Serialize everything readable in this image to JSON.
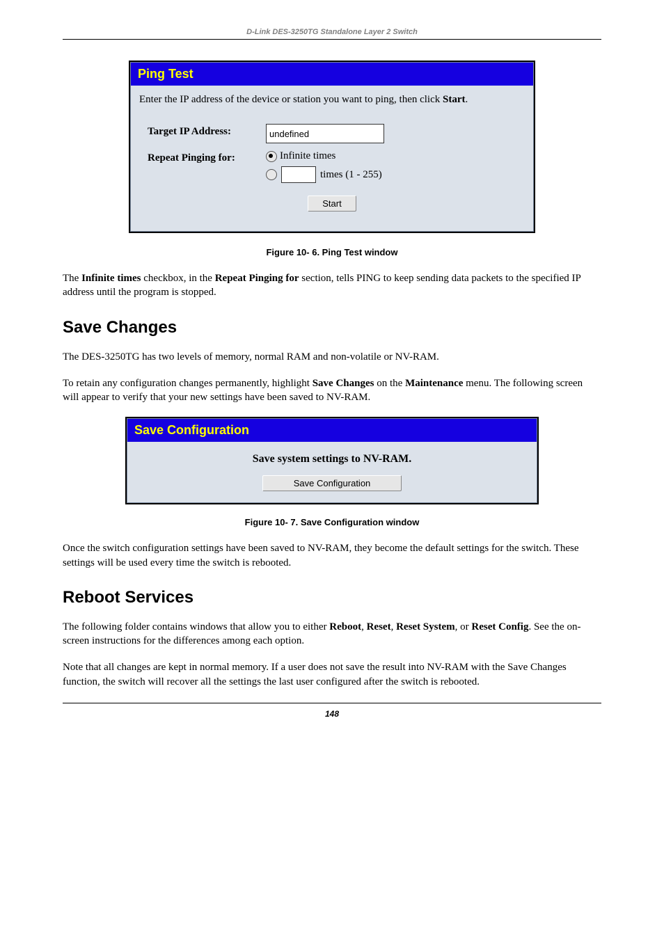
{
  "header": "D-Link DES-3250TG Standalone Layer 2 Switch",
  "ping": {
    "title": "Ping Test",
    "intro_prefix": "Enter the IP address of the device or station you want to ping, then click ",
    "intro_bold": "Start",
    "intro_suffix": ".",
    "target_label": "Target IP Address:",
    "target_value": "undefined",
    "repeat_label": "Repeat Pinging for:",
    "opt_infinite": "Infinite times",
    "times_suffix": "times (1 - 255)",
    "start_btn": "Start",
    "caption": "Figure 10- 6.  Ping Test window"
  },
  "para1_prefix": "The ",
  "para1_b1": "Infinite times",
  "para1_mid1": " checkbox, in the ",
  "para1_b2": "Repeat Pinging for",
  "para1_suffix": " section, tells PING to keep sending data packets to the specified IP address until the program is stopped.",
  "save": {
    "heading": "Save Changes",
    "p1": "The DES-3250TG has two levels of memory, normal RAM and non-volatile or NV-RAM.",
    "p2_prefix": "To retain any configuration changes permanently, highlight ",
    "p2_b1": "Save Changes",
    "p2_mid": " on the ",
    "p2_b2": "Maintenance",
    "p2_suffix": " menu. The following screen will appear to verify that your new settings have been saved to NV-RAM.",
    "panel_title": "Save Configuration",
    "panel_body_title": "Save system settings to NV-RAM.",
    "panel_btn": "Save Configuration",
    "caption": "Figure 10- 7.  Save Configuration window",
    "p3": "Once the switch configuration settings have been saved to NV-RAM, they become the default settings for the switch. These settings will be used every time the switch is rebooted."
  },
  "reboot": {
    "heading": "Reboot Services",
    "p1_prefix": "The following folder contains windows that allow you to either ",
    "p1_b1": "Reboot",
    "p1_s1": ", ",
    "p1_b2": "Reset",
    "p1_s2": ", ",
    "p1_b3": "Reset System",
    "p1_s3": ", or ",
    "p1_b4": "Reset Config",
    "p1_suffix": ". See the on-screen instructions for the differences among each option.",
    "p2": "Note that all changes are kept in normal memory. If a user does not save the result into NV-RAM with the Save Changes function, the switch will recover all the settings the last user configured after the switch is rebooted."
  },
  "page_number": "148"
}
